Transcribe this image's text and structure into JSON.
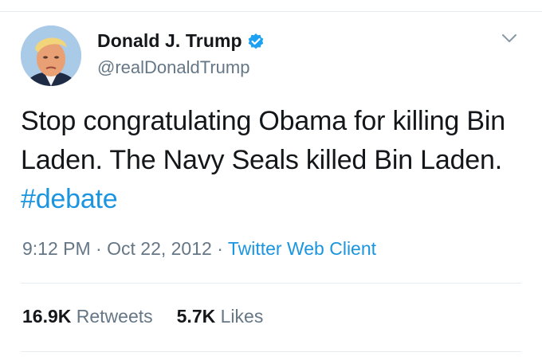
{
  "colors": {
    "accent": "#1b95e0",
    "text_primary": "#14171a",
    "text_secondary": "#657786",
    "divider": "#e6ecf0"
  },
  "author": {
    "name": "Donald J. Trump",
    "handle": "@realDonaldTrump",
    "verified": true,
    "avatar_icon": "profile-photo",
    "verified_icon": "verified-badge-icon",
    "menu_icon": "chevron-down-icon"
  },
  "tweet": {
    "text_before": "Stop congratulating Obama for killing Bin Laden. The Navy Seals killed Bin Laden. ",
    "hashtag": "#debate"
  },
  "meta": {
    "time": "9:12 PM",
    "separator1": " · ",
    "date": "Oct 22, 2012",
    "separator2": " · ",
    "source": "Twitter Web Client"
  },
  "stats": {
    "retweets_count": "16.9K",
    "retweets_label": "Retweets",
    "likes_count": "5.7K",
    "likes_label": "Likes"
  }
}
